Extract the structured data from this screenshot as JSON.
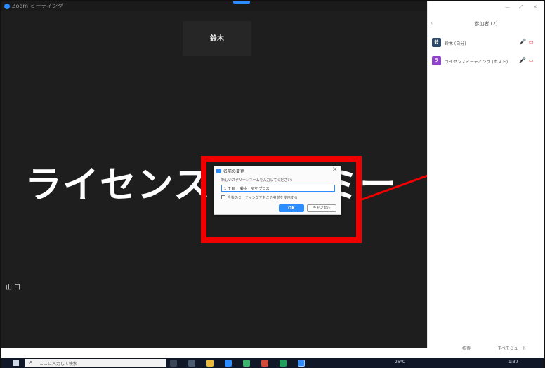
{
  "window": {
    "app_title": "Zoom ミーティング"
  },
  "meeting": {
    "name_tile": "鈴木",
    "big_name": "ライセンス　　　ミー",
    "small_tag": "山 口"
  },
  "dialog": {
    "title": "名前の変更",
    "close": "✕",
    "prompt": "新しいスクリーンネームを入力してください：",
    "input_value": "1 丁 目 　鈴木　ママ ブロス",
    "checkbox_label": "今後のミーティングでもこの名前を使用する",
    "ok_label": "OK",
    "cancel_label": "キャンセル"
  },
  "panel": {
    "header": "参加者 (2)",
    "back": "‹",
    "window_controls": [
      "—",
      "⤢",
      "✕"
    ],
    "participants": [
      {
        "initials": "鈴",
        "name": "鈴木 (自分)",
        "color": "#2e4a6b"
      },
      {
        "initials": "ラ",
        "name": "ライセンスミーティング (ホスト)",
        "color": "#8e44c8"
      }
    ],
    "invite_label": "招待",
    "mute_all_label": "すべてミュート"
  },
  "taskbar": {
    "search_placeholder": "ここに入力して検索",
    "weather": "26°C",
    "time": "1:30"
  },
  "colors": {
    "highlight": "#f20000",
    "zoom_blue": "#2d8cff",
    "meeting_bg": "#1e1e1e"
  }
}
